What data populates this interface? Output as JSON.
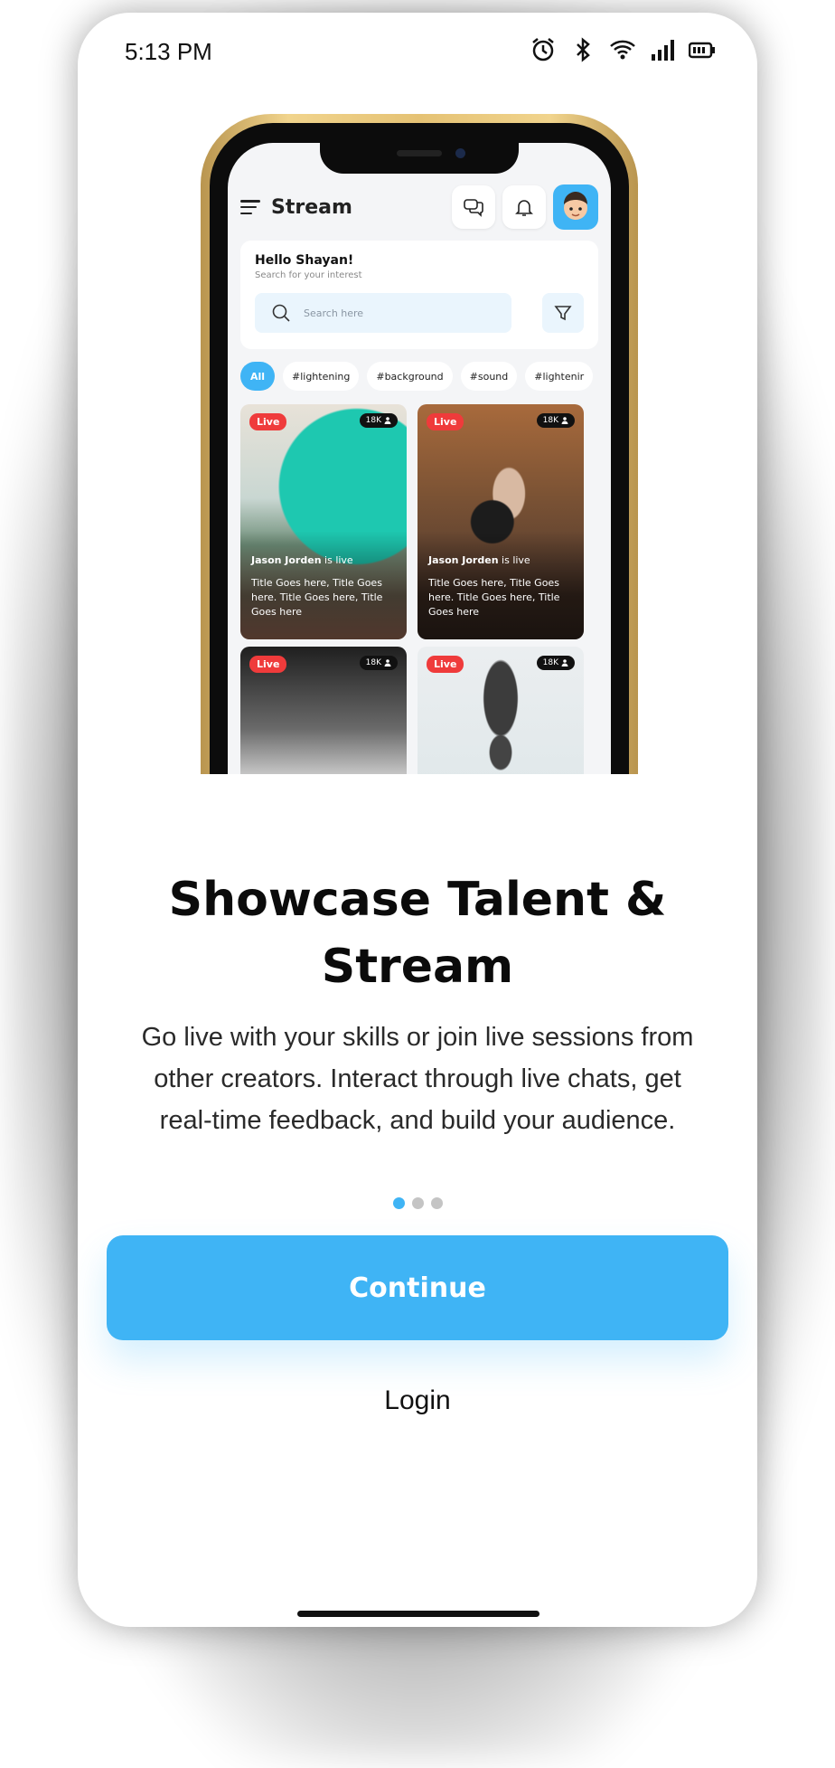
{
  "status_bar": {
    "time": "5:13 PM"
  },
  "mockup": {
    "app_title": "Stream",
    "greeting": "Hello Shayan!",
    "greeting_sub": "Search for your interest",
    "search_placeholder": "Search here",
    "chips": [
      "All",
      "#lightening",
      "#background",
      "#sound",
      "#lightenir"
    ],
    "cards": [
      {
        "badge": "Live",
        "viewers": "18K",
        "streamer": "Jason Jorden",
        "suffix": "is live",
        "title": "Title Goes here, Title Goes here. Title Goes here, Title Goes here"
      },
      {
        "badge": "Live",
        "viewers": "18K",
        "streamer": "Jason Jorden",
        "suffix": "is live",
        "title": "Title Goes here, Title Goes here. Title Goes here, Title Goes here"
      },
      {
        "badge": "Live",
        "viewers": "18K"
      },
      {
        "badge": "Live",
        "viewers": "18K"
      }
    ]
  },
  "onboarding": {
    "headline_line1": "Showcase Talent &",
    "headline_line2": "Stream",
    "description_line1": "Go live with your skills or join live sessions from",
    "description_line2": "other creators. Interact through live chats, get",
    "description_line3": "real-time feedback, and build your audience.",
    "page_indicator": {
      "current": 1,
      "total": 3
    },
    "continue_label": "Continue",
    "login_label": "Login"
  },
  "colors": {
    "accent": "#3fb4f5",
    "live_badge": "#ef3b3b",
    "dot_inactive": "#c4c4c4"
  },
  "icons": [
    "alarm-icon",
    "bluetooth-icon",
    "wifi-icon",
    "signal-icon",
    "battery-icon",
    "menu-icon",
    "chat-icon",
    "bell-icon",
    "search-icon",
    "filter-icon",
    "person-icon"
  ]
}
